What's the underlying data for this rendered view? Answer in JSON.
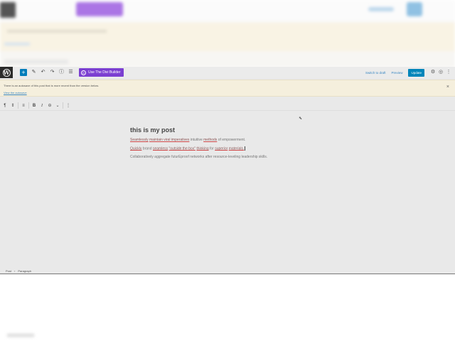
{
  "toolbar": {
    "add_icon": "plus-icon",
    "divi_label": "Use The Divi Builder",
    "switch_to_draft": "Switch to draft",
    "preview": "Preview",
    "update": "Update"
  },
  "notice": {
    "text": "There is an autosave of this post that is more recent than the version below.",
    "link": "View the autosave",
    "close": "×"
  },
  "post": {
    "title": "this is my post",
    "para1": [
      "Seamlessly",
      "maintain viral imperatives",
      "intuitive",
      "methods",
      "of empowerment."
    ],
    "para2": [
      "Quickly",
      "brand",
      "seamless",
      "\"outside the box\"",
      "thinking",
      "for",
      "superior",
      "materials."
    ],
    "para3": "Collaboratively aggregate futurEproof networks after resource-leveling leadership skills."
  },
  "footer": {
    "crumb1": "Post",
    "sep": "›",
    "crumb2": "Paragraph"
  }
}
